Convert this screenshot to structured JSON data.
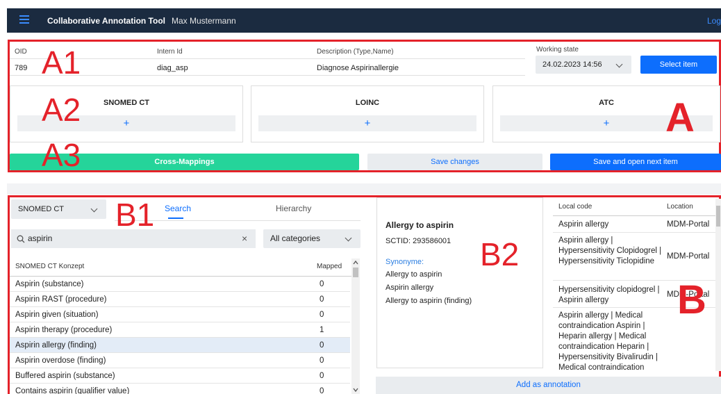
{
  "app": {
    "title": "Collaborative Annotation Tool",
    "user": "Max Mustermann",
    "logout": "Logout"
  },
  "header": {
    "oid_label": "OID",
    "oid_value": "789",
    "intern_label": "Intern Id",
    "intern_value": "diag_asp",
    "desc_label": "Description (Type,Name)",
    "desc_value": "Diagnose Aspirinallergie",
    "state_label": "Working state",
    "state_value": "24.02.2023 14:56",
    "select_item": "Select item"
  },
  "terminologies": [
    {
      "name": "SNOMED CT",
      "add": "+"
    },
    {
      "name": "LOINC",
      "add": "+"
    },
    {
      "name": "ATC",
      "add": "+"
    }
  ],
  "actions": {
    "cross_mappings": "Cross-Mappings",
    "save_changes": "Save changes",
    "save_next": "Save and open next item"
  },
  "region_labels": {
    "a": "A",
    "a1": "A1",
    "a2": "A2",
    "a3": "A3",
    "b": "B",
    "b1": "B1",
    "b2": "B2"
  },
  "search_panel": {
    "terminology": "SNOMED CT",
    "tab_search": "Search",
    "tab_hierarchy": "Hierarchy",
    "query": "aspirin",
    "clear": "×",
    "category": "All categories",
    "col_concept": "SNOMED CT Konzept",
    "col_mapped": "Mapped",
    "rows": [
      {
        "name": "Aspirin (substance)",
        "mapped": "0"
      },
      {
        "name": "Aspirin RAST (procedure)",
        "mapped": "0"
      },
      {
        "name": "Aspirin given (situation)",
        "mapped": "0"
      },
      {
        "name": "Aspirin therapy (procedure)",
        "mapped": "1"
      },
      {
        "name": "Aspirin allergy (finding)",
        "mapped": "0"
      },
      {
        "name": "Aspirin overdose (finding)",
        "mapped": "0"
      },
      {
        "name": "Buffered aspirin (substance)",
        "mapped": "0"
      },
      {
        "name": "Contains aspirin (qualifier value)",
        "mapped": "0"
      }
    ]
  },
  "detail": {
    "title": "Allergy to aspirin",
    "sctid": "SCTID: 293586001",
    "synonyms_label": "Synonyme:",
    "synonyms": [
      "Allergy to aspirin",
      "Aspirin allergy",
      "Allergy to aspirin (finding)"
    ]
  },
  "local_codes": {
    "col_code": "Local code",
    "col_location": "Location",
    "rows": [
      {
        "code": "Aspirin allergy",
        "location": "MDM-Portal"
      },
      {
        "code": "Aspirin allergy | Hypersensitivity Clopidogrel | Hypersensitivity Ticlopidine",
        "location": "MDM-Portal"
      },
      {
        "code": "Hypersensitivity clopidogrel | Aspirin allergy",
        "location": "MDM-Portal"
      },
      {
        "code": "Aspirin allergy | Medical contraindication Aspirin | Heparin allergy | Medical contraindication Heparin | Hypersensitivity Bivalirudin | Medical contraindication",
        "location": ""
      }
    ]
  },
  "add_annotation": "Add as annotation",
  "colors": {
    "accent": "#0d6efd",
    "success": "#25d49a",
    "navbar": "#1b2b40",
    "annotation": "#e4222a"
  }
}
